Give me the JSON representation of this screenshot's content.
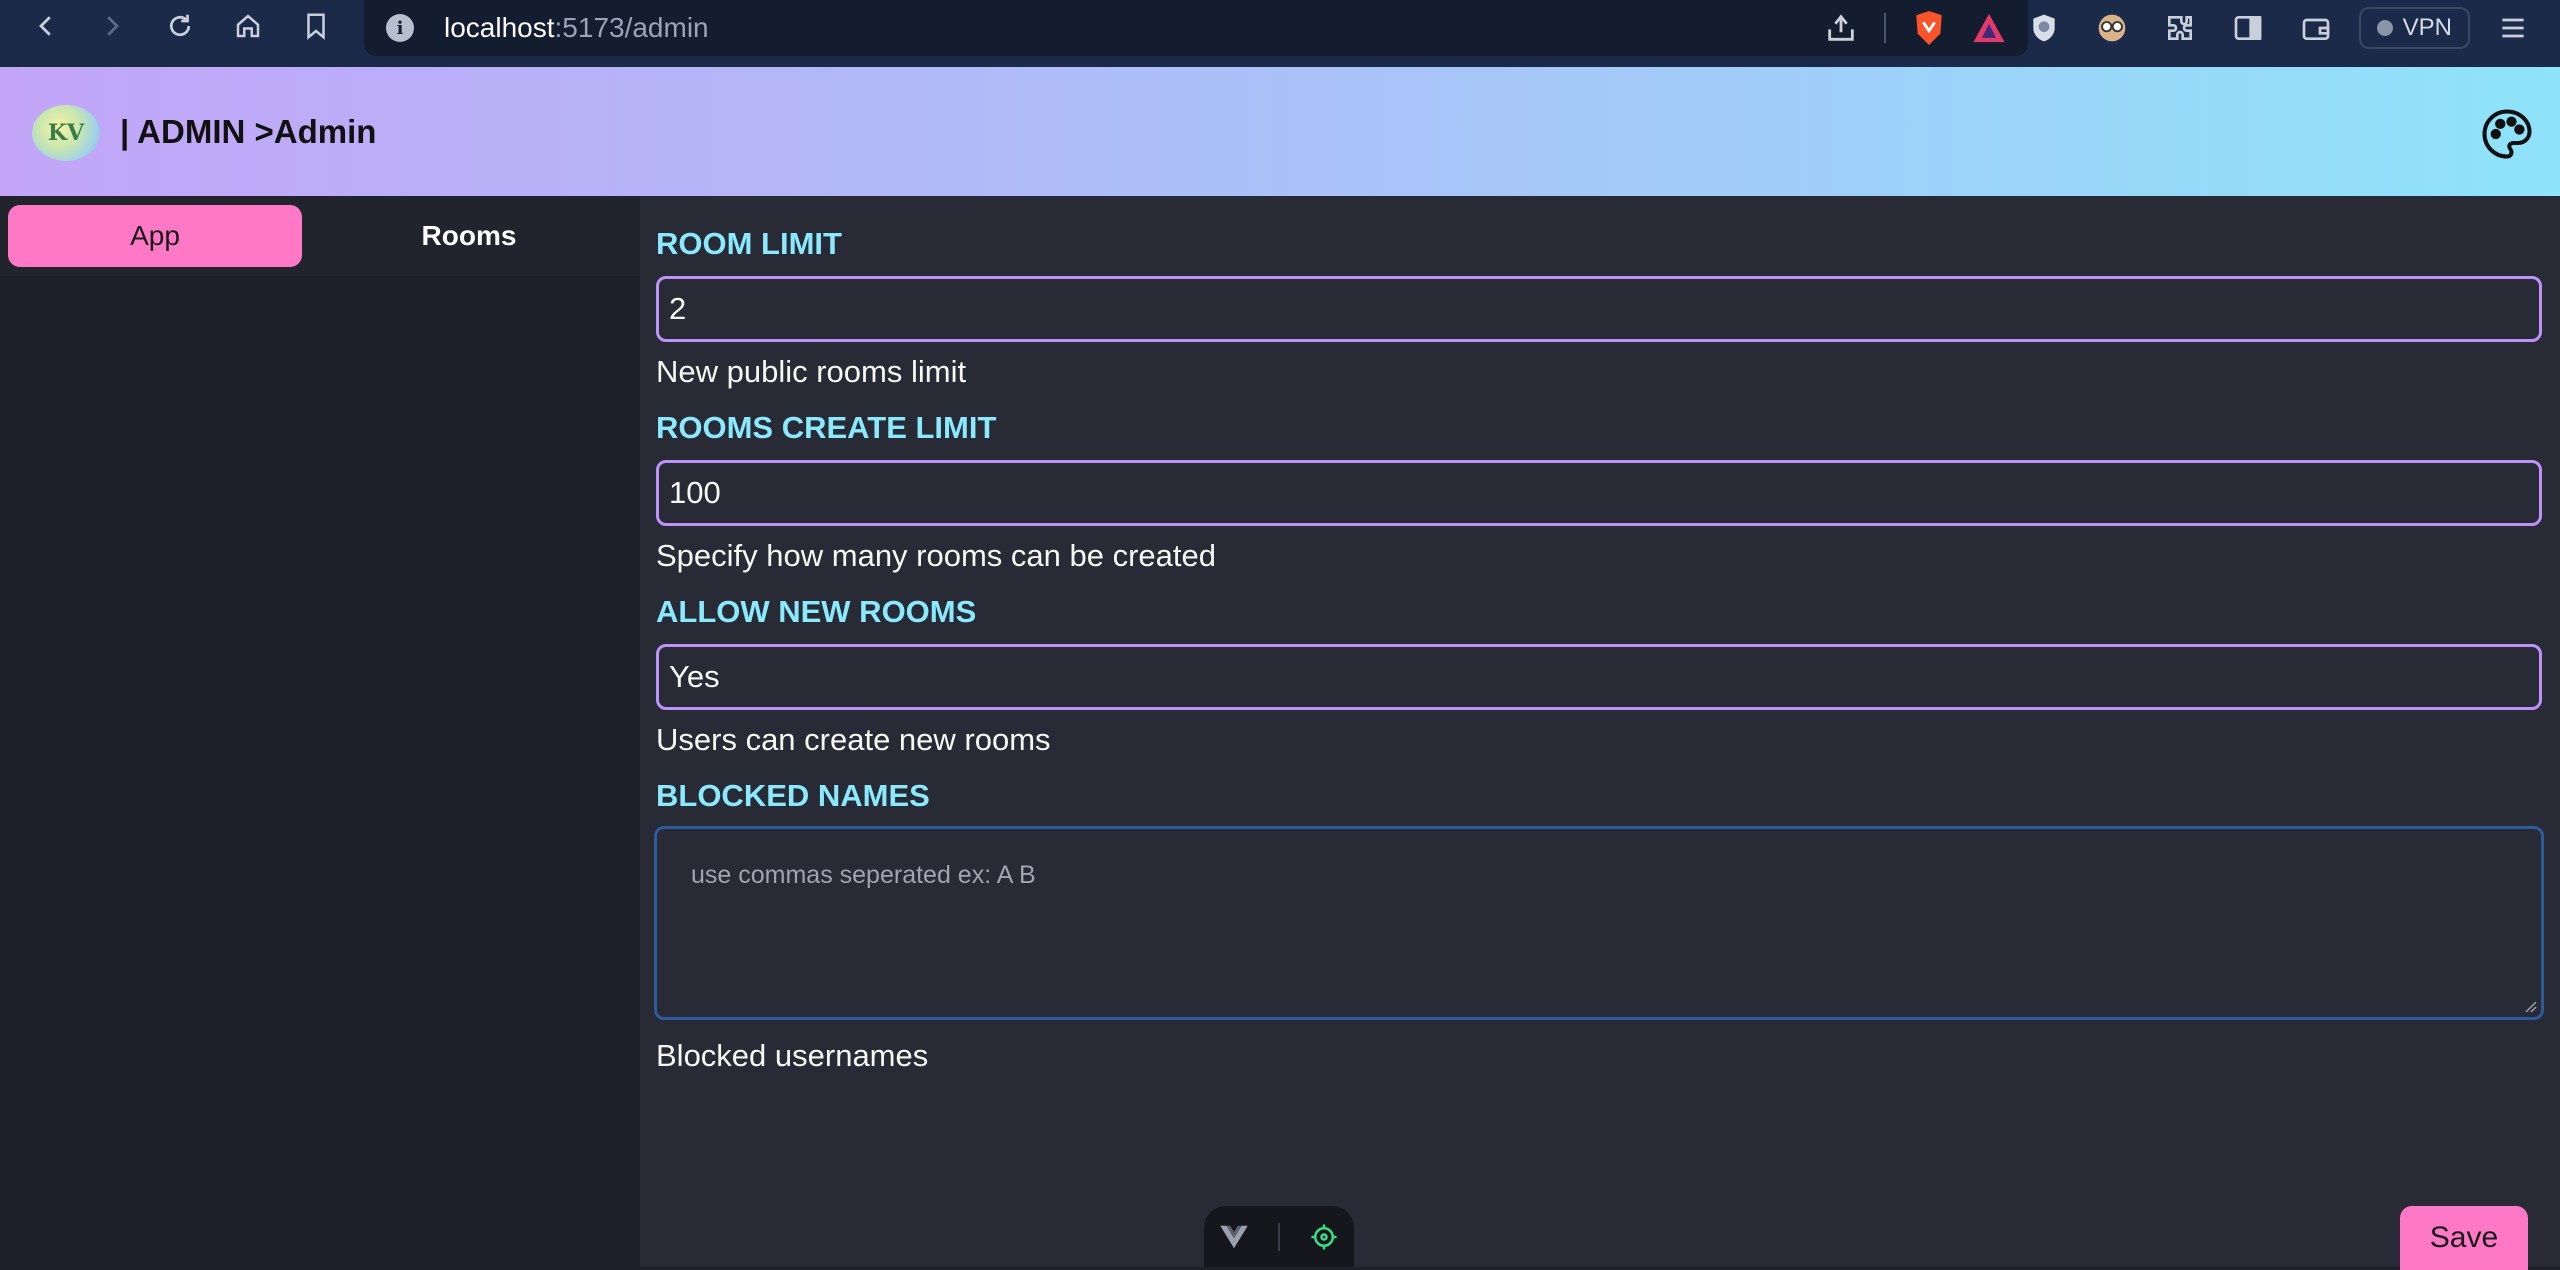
{
  "browser": {
    "url_host": "localhost",
    "url_path": ":5173/admin",
    "vpn_label": "VPN"
  },
  "header": {
    "logo_text": "KV",
    "title": "| ADMIN >Admin"
  },
  "sidebar": {
    "tabs": [
      {
        "label": "App",
        "active": true
      },
      {
        "label": "Rooms",
        "active": false
      }
    ]
  },
  "form": {
    "fields": [
      {
        "label": "ROOM LIMIT",
        "value": "2",
        "help": "New public rooms limit"
      },
      {
        "label": "ROOMS CREATE LIMIT",
        "value": "100",
        "help": "Specify how many rooms can be created"
      },
      {
        "label": "ALLOW NEW ROOMS",
        "value": "Yes",
        "help": "Users can create new rooms"
      }
    ],
    "blocked": {
      "label": "BLOCKED NAMES",
      "placeholder": "use commas seperated ex: A B",
      "help": "Blocked usernames"
    },
    "save_label": "Save"
  },
  "colors": {
    "accent_pink": "#ff78c6",
    "label_cyan": "#8be9fd",
    "input_border_purple": "#bd93f9",
    "main_bg": "#282a36"
  }
}
